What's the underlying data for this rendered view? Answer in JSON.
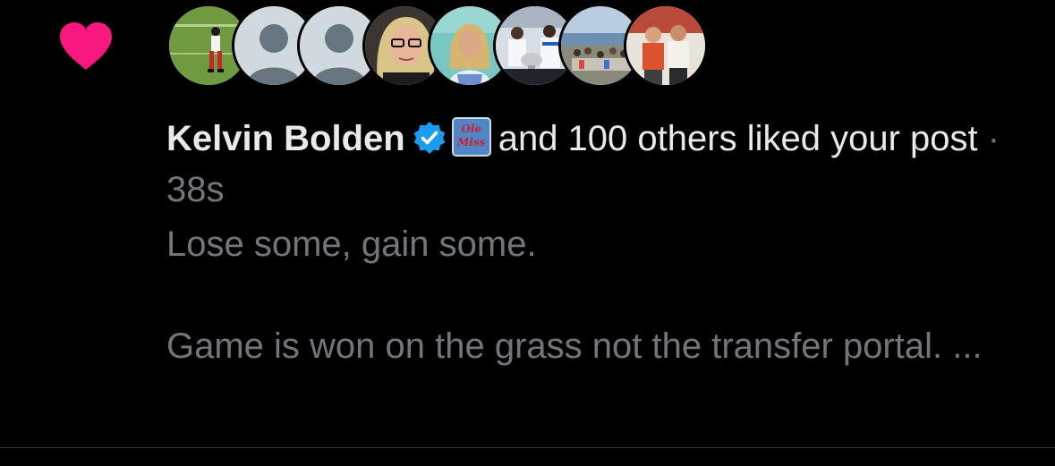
{
  "notification": {
    "type_icon": "heart-icon",
    "like_color": "#f91880",
    "avatars": [
      {
        "icon": "football-player-photo"
      },
      {
        "icon": "default-avatar-icon"
      },
      {
        "icon": "default-avatar-icon"
      },
      {
        "icon": "woman-glasses-photo"
      },
      {
        "icon": "woman-beach-photo"
      },
      {
        "icon": "team-trophy-photo"
      },
      {
        "icon": "lake-group-photo"
      },
      {
        "icon": "two-men-photo"
      }
    ],
    "liker_name": "Kelvin Bolden",
    "verified_icon": "verified-badge-icon",
    "verified_color": "#1d9bf0",
    "affiliate_badge_text": "Ole Miss",
    "action_text": "and 100 others liked your post",
    "separator": "·",
    "timestamp": "38s",
    "post_preview": {
      "line1": "Lose some, gain some.",
      "line2": "Game is won on the grass not the transfer portal. ..."
    }
  }
}
